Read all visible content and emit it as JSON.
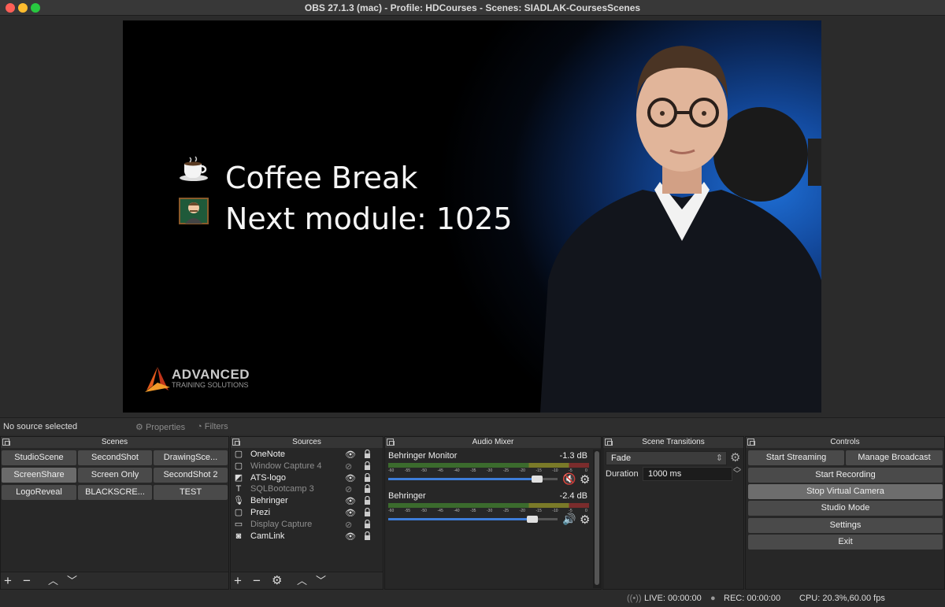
{
  "window": {
    "title": "OBS 27.1.3 (mac) - Profile: HDCourses - Scenes: SIADLAK-CoursesScenes"
  },
  "preview": {
    "line1": "Coffee Break",
    "line2": "Next module: 1025",
    "logo_brand": "ADVANCED",
    "logo_sub": "TRAINING SOLUTIONS"
  },
  "source_bar": {
    "no_selection": "No source selected",
    "properties": "Properties",
    "filters": "Filters"
  },
  "scenes": {
    "title": "Scenes",
    "items": [
      "StudioScene",
      "SecondShot",
      "DrawingSce...",
      "ScreenShare",
      "Screen Only",
      "SecondShot 2",
      "LogoReveal",
      "BLACKSCRE...",
      "TEST"
    ],
    "selected": "ScreenShare"
  },
  "sources": {
    "title": "Sources",
    "items": [
      {
        "name": "OneNote",
        "icon": "window-icon",
        "visible": true
      },
      {
        "name": "Window Capture 4",
        "icon": "window-icon",
        "visible": false
      },
      {
        "name": "ATS-logo",
        "icon": "image-icon",
        "visible": true
      },
      {
        "name": "SQLBootcamp 3",
        "icon": "text-icon",
        "visible": false
      },
      {
        "name": "Behringer",
        "icon": "microphone-icon",
        "visible": true
      },
      {
        "name": "Prezi",
        "icon": "window-icon",
        "visible": true
      },
      {
        "name": "Display Capture",
        "icon": "monitor-icon",
        "visible": false
      },
      {
        "name": "CamLink",
        "icon": "camera-icon",
        "visible": true
      }
    ]
  },
  "mixer": {
    "title": "Audio Mixer",
    "channels": [
      {
        "name": "Behringer Monitor",
        "db": "-1.3 dB",
        "level": 0.88,
        "muted": true
      },
      {
        "name": "Behringer",
        "db": "-2.4 dB",
        "level": 0.85,
        "muted": false
      }
    ],
    "tick_labels": [
      "-60",
      "-55",
      "-50",
      "-45",
      "-40",
      "-35",
      "-30",
      "-25",
      "-20",
      "-15",
      "-10",
      "-5",
      "0"
    ]
  },
  "transitions": {
    "title": "Scene Transitions",
    "selected": "Fade",
    "duration_label": "Duration",
    "duration_value": "1000 ms"
  },
  "controls": {
    "title": "Controls",
    "start_streaming": "Start Streaming",
    "manage_broadcast": "Manage Broadcast",
    "start_recording": "Start Recording",
    "stop_virtual_camera": "Stop Virtual Camera",
    "studio_mode": "Studio Mode",
    "settings": "Settings",
    "exit": "Exit"
  },
  "status": {
    "live": "LIVE: 00:00:00",
    "rec": "REC: 00:00:00",
    "cpu": "CPU: 20.3%,60.00 fps"
  },
  "colors": {
    "accent": "#3e7dd8",
    "muted_red": "#d03030"
  }
}
